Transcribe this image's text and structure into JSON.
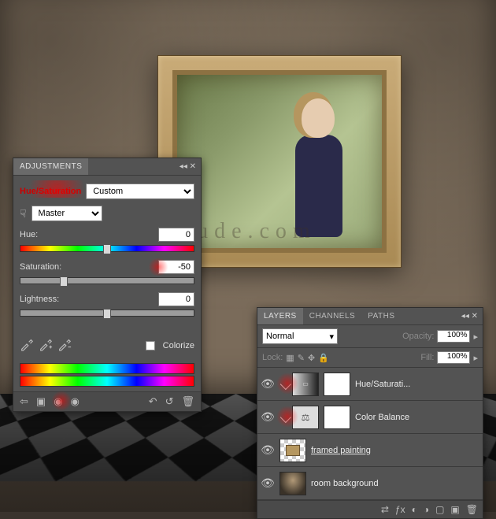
{
  "watermark": "www.psd-dude.com",
  "adjustments": {
    "title": "ADJUSTMENTS",
    "sub_title": "Hue/Saturation",
    "preset": "Custom",
    "channel": "Master",
    "hue_label": "Hue:",
    "hue_value": "0",
    "sat_label": "Saturation:",
    "sat_value": "-50",
    "light_label": "Lightness:",
    "light_value": "0",
    "colorize_label": "Colorize"
  },
  "layers_panel": {
    "tabs": {
      "layers": "LAYERS",
      "channels": "CHANNELS",
      "paths": "PATHS"
    },
    "blend_mode": "Normal",
    "opacity_label": "Opacity:",
    "opacity_value": "100%",
    "lock_label": "Lock:",
    "fill_label": "Fill:",
    "fill_value": "100%",
    "layers": [
      {
        "name": "Hue/Saturati..."
      },
      {
        "name": "Color Balance"
      },
      {
        "name": "framed painting"
      },
      {
        "name": "room background"
      }
    ]
  }
}
